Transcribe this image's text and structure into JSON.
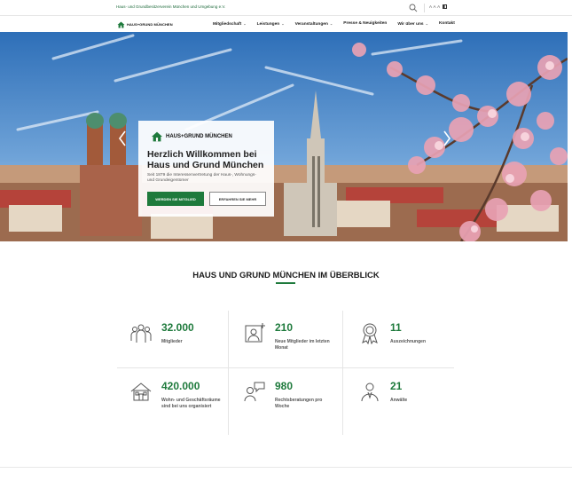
{
  "topbar": {
    "association": "Haus- und Grundbesitzerverein München und Umgebung e.V.",
    "font_sizes": "A A A",
    "icons": [
      "search-icon",
      "contrast-icon"
    ]
  },
  "nav": {
    "logo_text": "HAUS+GRUND MÜNCHEN",
    "items": [
      {
        "label": "Mitgliedschaft",
        "has_dropdown": true
      },
      {
        "label": "Leistungen",
        "has_dropdown": true
      },
      {
        "label": "Veranstaltungen",
        "has_dropdown": true
      },
      {
        "label": "Presse & Neuigkeiten",
        "has_dropdown": false
      },
      {
        "label": "Wir über uns",
        "has_dropdown": true
      },
      {
        "label": "Kontakt",
        "has_dropdown": false
      }
    ],
    "chevron": "⌄"
  },
  "hero": {
    "logo_text": "HAUS+GRUND MÜNCHEN",
    "title": "Herzlich Willkommen bei Haus und Grund München",
    "subtitle": "Seit 1879 die Interessenvertretung der Haus-, Wohnungs- und Grundeigentümer",
    "primary_button": "WERDEN SIE MITGLIED",
    "secondary_button": "ERFAHREN SIE MEHR",
    "icons": [
      "chevron-left-icon",
      "chevron-right-icon"
    ]
  },
  "overview": {
    "title": "HAUS UND GRUND MÜNCHEN IM ÜBERBLICK",
    "stats": [
      {
        "icon": "members-icon",
        "value": "32.000",
        "label": "Mitglieder"
      },
      {
        "icon": "new-member-icon",
        "value": "210",
        "label": "Neue Mitglieder im letzten Monat"
      },
      {
        "icon": "award-icon",
        "value": "11",
        "label": "Auszeichnungen"
      },
      {
        "icon": "house-icon",
        "value": "420.000",
        "label": "Wohn- und Geschäftsräume sind bei uns organisiert"
      },
      {
        "icon": "consultation-icon",
        "value": "980",
        "label": "Rechtsberatungen pro Woche"
      },
      {
        "icon": "lawyer-icon",
        "value": "21",
        "label": "Anwälte"
      }
    ]
  },
  "colors": {
    "brand_green": "#1e7a3c",
    "sky": "#3d7dc4"
  }
}
